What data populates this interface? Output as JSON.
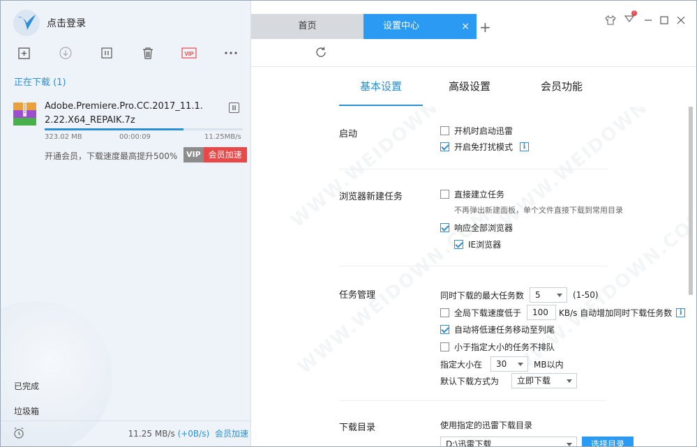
{
  "app": {
    "login_text": "点击登录"
  },
  "left": {
    "toolbar": [
      {
        "name": "new-task-icon"
      },
      {
        "name": "start-icon"
      },
      {
        "name": "pause-all-icon"
      },
      {
        "name": "delete-icon"
      },
      {
        "name": "vip-icon",
        "label": "VIP"
      },
      {
        "name": "more-icon",
        "label": "•••"
      }
    ],
    "section_downloading": "正在下载 (1)",
    "task": {
      "filename": "Adobe.Premiere.Pro.CC.2017_11.1.2.22.X64_REPAIK.7z",
      "size": "323.02 MB",
      "eta": "00:00:09",
      "speed": "11.25MB/s",
      "progress": 0.7,
      "vip_tip": "开通会员，下载速度最高提升500%",
      "vip_badge": "VIP",
      "vip_accelerate": "会员加速"
    },
    "completed": "已完成",
    "trash": "垃圾箱",
    "bottom": {
      "speed": "11.25 MB/s",
      "up": "(+0B/s)",
      "accelerate": "会员加速"
    }
  },
  "right": {
    "tabs": {
      "home": "首页",
      "settings": "设置中心",
      "close": "×",
      "add": "+"
    },
    "settings_tabs": [
      "基本设置",
      "高级设置",
      "会员功能"
    ],
    "groups": {
      "startup": {
        "title": "启动",
        "opt1": "开机时启动迅雷",
        "opt2": "开启免打扰模式"
      },
      "browser": {
        "title": "浏览器新建任务",
        "opt1": "直接建立任务",
        "hint": "不再弹出新建面板，单个文件直接下载到常用目录",
        "opt2": "响应全部浏览器",
        "opt3": "IE浏览器"
      },
      "task_mgmt": {
        "title": "任务管理",
        "max_tasks_label": "同时下载的最大任务数",
        "max_tasks_value": "5",
        "max_tasks_range": "(1-50)",
        "global_low_label": "全局下载速度低于",
        "global_low_value": "100",
        "global_low_suffix": "KB/s 自动增加同时下载任务数",
        "opt_move_low": "自动将低速任务移动至列尾",
        "opt_small_noqueue": "小于指定大小的任务不排队",
        "size_label": "指定大小在",
        "size_value": "30",
        "size_suffix": "MB以内",
        "default_mode_label": "默认下载方式为",
        "default_mode_value": "立即下载"
      },
      "download_dir": {
        "title": "下载目录",
        "label": "使用指定的迅雷下载目录",
        "path": "D:\\迅雷下载",
        "choose": "选择目录"
      }
    },
    "watermark": "WWW.WEIDOWN.COM"
  },
  "colors": {
    "accent": "#2b8fd6",
    "tab_active": "#2b9af3",
    "vip_red": "#e84848"
  }
}
